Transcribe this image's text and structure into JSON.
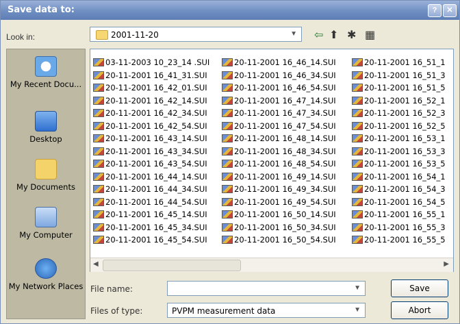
{
  "window": {
    "title": "Save data to:",
    "help_glyph": "?",
    "close_glyph": "✕"
  },
  "lookin": {
    "label": "Look in:",
    "value": "2001-11-20"
  },
  "places": [
    {
      "label": "My Recent Docu...",
      "icon": "recent-documents-icon"
    },
    {
      "label": "Desktop",
      "icon": "desktop-icon"
    },
    {
      "label": "My Documents",
      "icon": "my-documents-icon"
    },
    {
      "label": "My Computer",
      "icon": "my-computer-icon"
    },
    {
      "label": "My Network Places",
      "icon": "network-places-icon"
    }
  ],
  "files": {
    "col1": [
      "03-11-2003  10_23_14 .SUI",
      "20-11-2001 16_41_31.SUI",
      "20-11-2001 16_42_01.SUI",
      "20-11-2001 16_42_14.SUI",
      "20-11-2001 16_42_34.SUI",
      "20-11-2001 16_42_54.SUI",
      "20-11-2001 16_43_14.SUI",
      "20-11-2001 16_43_34.SUI",
      "20-11-2001 16_43_54.SUI",
      "20-11-2001 16_44_14.SUI",
      "20-11-2001 16_44_34.SUI",
      "20-11-2001 16_44_54.SUI",
      "20-11-2001 16_45_14.SUI",
      "20-11-2001 16_45_34.SUI",
      "20-11-2001 16_45_54.SUI"
    ],
    "col2": [
      "20-11-2001 16_46_14.SUI",
      "20-11-2001 16_46_34.SUI",
      "20-11-2001 16_46_54.SUI",
      "20-11-2001 16_47_14.SUI",
      "20-11-2001 16_47_34.SUI",
      "20-11-2001 16_47_54.SUI",
      "20-11-2001 16_48_14.SUI",
      "20-11-2001 16_48_34.SUI",
      "20-11-2001 16_48_54.SUI",
      "20-11-2001 16_49_14.SUI",
      "20-11-2001 16_49_34.SUI",
      "20-11-2001 16_49_54.SUI",
      "20-11-2001 16_50_14.SUI",
      "20-11-2001 16_50_34.SUI",
      "20-11-2001 16_50_54.SUI"
    ],
    "col3": [
      "20-11-2001 16_51_1",
      "20-11-2001 16_51_3",
      "20-11-2001 16_51_5",
      "20-11-2001 16_52_1",
      "20-11-2001 16_52_3",
      "20-11-2001 16_52_5",
      "20-11-2001 16_53_1",
      "20-11-2001 16_53_3",
      "20-11-2001 16_53_5",
      "20-11-2001 16_54_1",
      "20-11-2001 16_54_3",
      "20-11-2001 16_54_5",
      "20-11-2001 16_55_1",
      "20-11-2001 16_55_3",
      "20-11-2001 16_55_5"
    ]
  },
  "form": {
    "filename_label": "File name:",
    "filename_value": "",
    "filetype_label": "Files of type:",
    "filetype_value": "PVPM measurement data"
  },
  "buttons": {
    "save": "Save",
    "abort": "Abort"
  }
}
